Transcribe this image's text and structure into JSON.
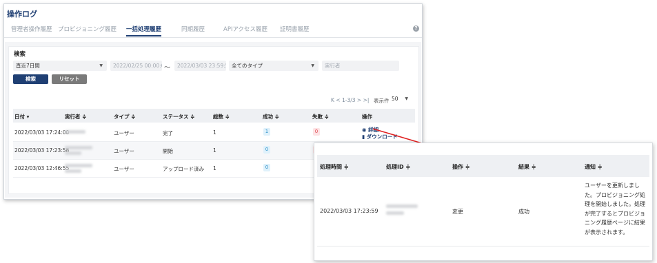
{
  "page": {
    "title": "操作ログ"
  },
  "tabs": [
    {
      "label": "管理者操作履歴"
    },
    {
      "label": "プロビジョニング履歴"
    },
    {
      "label": "一括処理履歴"
    },
    {
      "label": "同期履歴"
    },
    {
      "label": "APIアクセス履歴"
    },
    {
      "label": "証明書履歴"
    }
  ],
  "search": {
    "heading": "検索",
    "period_value": "直近7日間",
    "date_from": "2022/02/25 00:00:0(",
    "tilde": "～",
    "date_to": "2022/03/03 23:59:59",
    "type_value": "全てのタイプ",
    "executor_placeholder": "実行者",
    "search_button": "検索",
    "reset_button": "リセット"
  },
  "pager": {
    "nav_text": "K < 1-3/3 > >|",
    "per_page_label": "表示件数:",
    "per_page_value": "50"
  },
  "table": {
    "headers": {
      "date": "日付 ▾",
      "executor": "実行者 ≑",
      "type": "タイプ ≑",
      "status": "ステータス ≑",
      "total": "総数 ≑",
      "success": "成功 ≑",
      "failure": "失敗 ≑",
      "action": "操作"
    },
    "rows": [
      {
        "date": "2022/03/03 17:24:00",
        "type": "ユーザー",
        "status": "完了",
        "total": "1",
        "success": "1",
        "failure": "0"
      },
      {
        "date": "2022/03/03 17:23:58",
        "type": "ユーザー",
        "status": "開始",
        "total": "1",
        "success": "0",
        "failure": ""
      },
      {
        "date": "2022/03/03 12:46:55",
        "type": "ユーザー",
        "status": "アップロード済み",
        "total": "1",
        "success": "0",
        "failure": ""
      }
    ],
    "actions": {
      "details": "詳細",
      "download": "ダウンロード"
    }
  },
  "detail": {
    "headers": {
      "time": "処理時間 ≑",
      "id": "処理ID ≑",
      "operation": "操作 ≑",
      "result": "結果 ≑",
      "notice": "通知 ≑"
    },
    "row": {
      "time": "2022/03/03 17:23:59",
      "operation": "変更",
      "result": "成功",
      "notice": "ユーザーを更新しました。プロビジョニング処理を開始しました。処理が完了するとプロビジョニング履歴ページに結果が表示されます。"
    }
  },
  "colors": {
    "primary": "#1f3f73",
    "reset": "#7a7a7a",
    "arrow": "#e02020",
    "success_badge": "#2a8fc8",
    "failure_badge": "#e0464e"
  }
}
